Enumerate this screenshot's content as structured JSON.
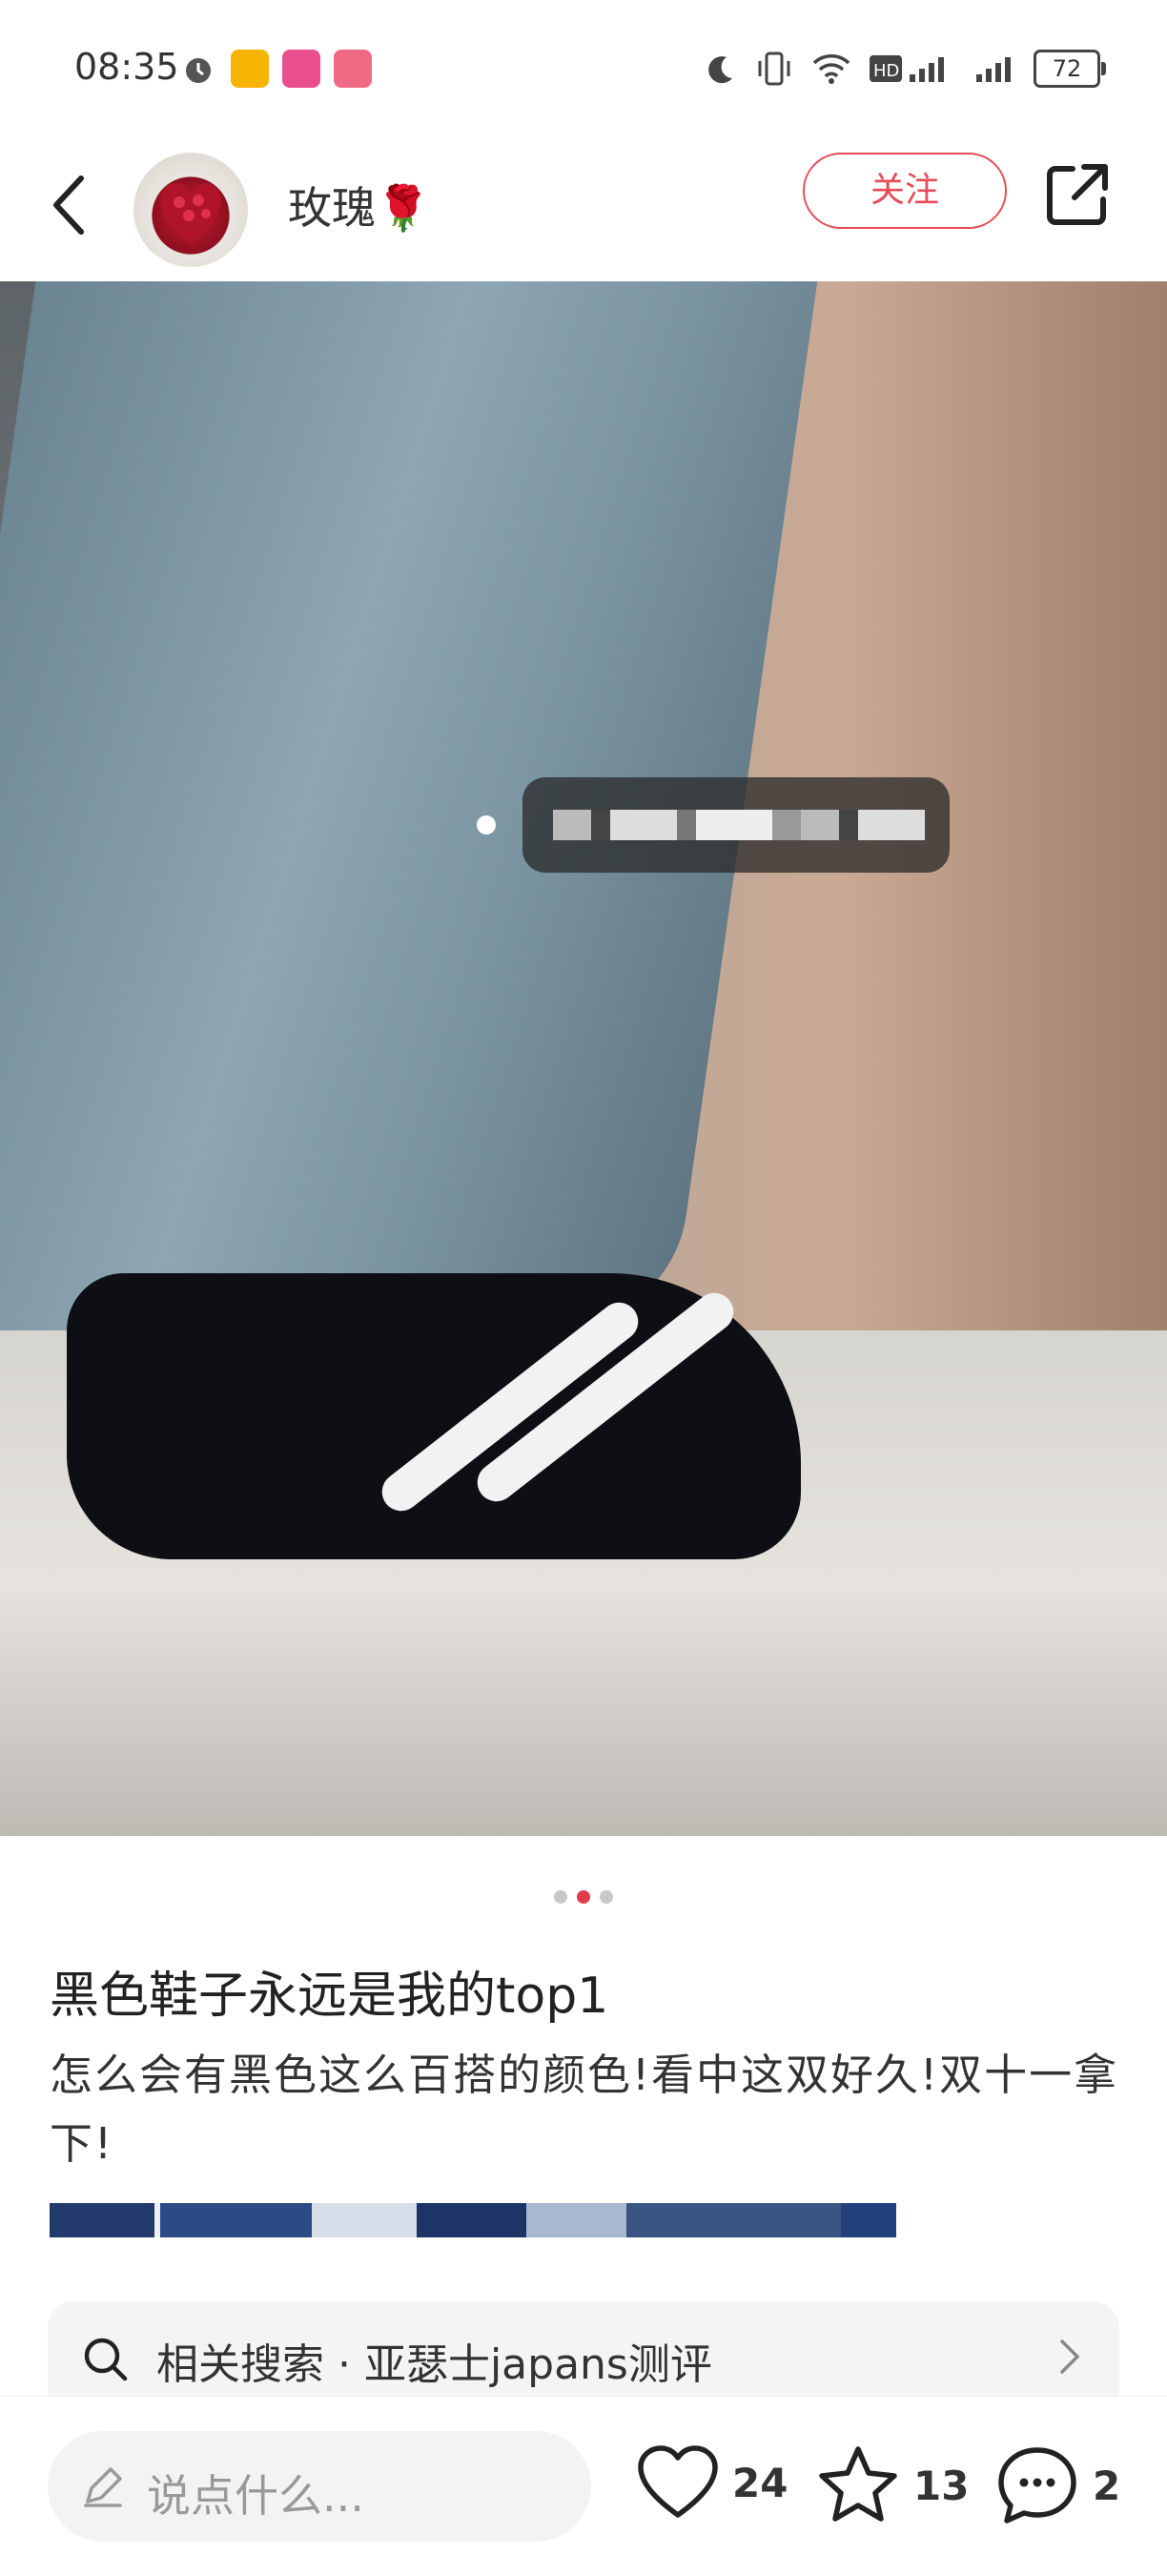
{
  "status_bar": {
    "time": "08:35",
    "battery": "72"
  },
  "header": {
    "username": "玫瑰🌹",
    "follow_label": "关注"
  },
  "post": {
    "title": "黑色鞋子永远是我的top1",
    "description": "怎么会有黑色这么百搭的颜色!看中这双好久!双十一拿下!",
    "carousel": {
      "total": 3,
      "current": 2
    }
  },
  "related_search": {
    "label": "相关搜索 · 亚瑟士japans测评"
  },
  "bottom_bar": {
    "comment_placeholder": "说点什么...",
    "likes": "24",
    "favorites": "13",
    "comments": "2"
  },
  "colors": {
    "accent": "#e64b58",
    "active_dot": "#e23b4a"
  }
}
